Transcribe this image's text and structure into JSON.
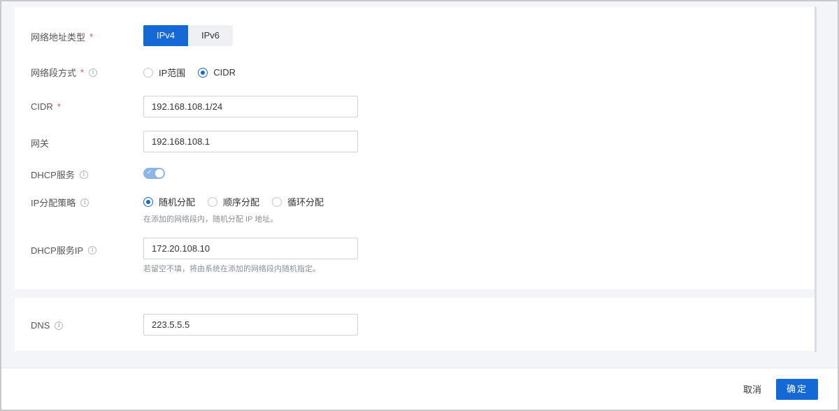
{
  "form": {
    "address_type": {
      "label": "网络地址类型",
      "required": "*",
      "options": [
        "IPv4",
        "IPv6"
      ],
      "selected": "IPv4"
    },
    "segment_mode": {
      "label": "网络段方式",
      "required": "*",
      "options": [
        "IP范围",
        "CIDR"
      ],
      "selected": "CIDR"
    },
    "cidr": {
      "label": "CIDR",
      "required": "*",
      "value": "192.168.108.1/24"
    },
    "gateway": {
      "label": "网关",
      "value": "192.168.108.1"
    },
    "dhcp_service": {
      "label": "DHCP服务",
      "enabled": true,
      "check_glyph": "✓"
    },
    "ip_strategy": {
      "label": "IP分配策略",
      "options": [
        "随机分配",
        "顺序分配",
        "循环分配"
      ],
      "selected": "随机分配",
      "hint": "在添加的网络段内，随机分配 IP 地址。"
    },
    "dhcp_ip": {
      "label": "DHCP服务IP",
      "value": "172.20.108.10",
      "hint": "若留空不填，将由系统在添加的网络段内随机指定。"
    },
    "dns": {
      "label": "DNS",
      "value": "223.5.5.5"
    }
  },
  "footer": {
    "cancel_label": "取消",
    "ok_label": "确定"
  },
  "icons": {
    "info": "info-icon"
  },
  "colors": {
    "primary": "#1469d6",
    "required": "#e34d59",
    "toggle_on": "#8db5ea"
  }
}
